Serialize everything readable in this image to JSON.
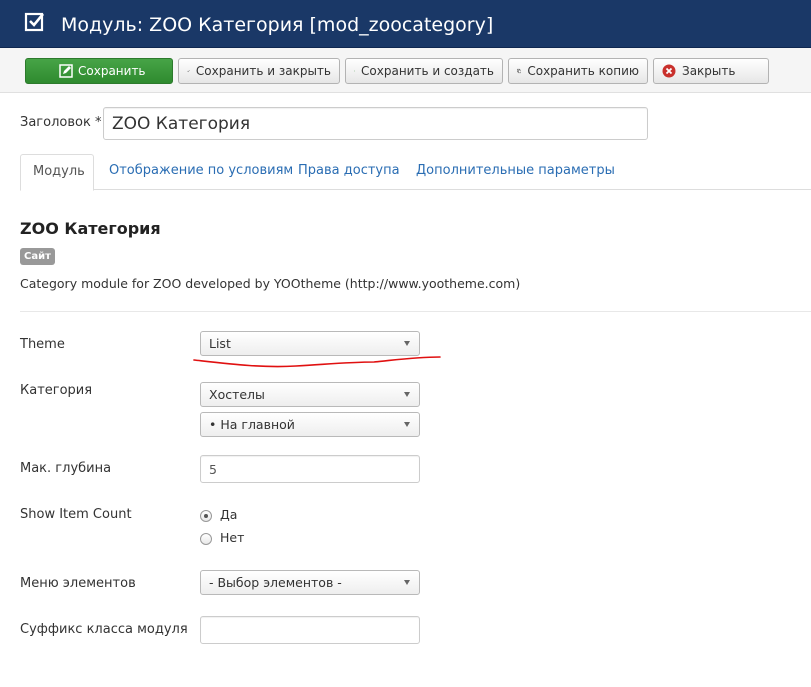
{
  "header": {
    "title": "Модуль: ZOO Категория [mod_zoocategory]",
    "icon": "checkbox-icon"
  },
  "toolbar": {
    "save_label": "Сохранить",
    "save_close_label": "Сохранить и закрыть",
    "save_new_label": "Сохранить и создать",
    "save_copy_label": "Сохранить копию",
    "close_label": "Закрыть"
  },
  "form": {
    "title_label": "Заголовок *",
    "title_value": "ZOO Категория"
  },
  "tabs": [
    {
      "label": "Модуль",
      "active": true
    },
    {
      "label": "Отображение по условиям",
      "active": false
    },
    {
      "label": "Права доступа",
      "active": false
    },
    {
      "label": "Дополнительные параметры",
      "active": false
    }
  ],
  "module": {
    "name": "ZOO Категория",
    "badge": "Сайт",
    "description": "Category module for ZOO developed by YOOtheme (http://www.yootheme.com)"
  },
  "fields": {
    "theme_label": "Theme",
    "theme_value": "List",
    "category_label": "Категория",
    "category_value": "Хостелы",
    "category_sub_value": "• На главной",
    "depth_label": "Мак. глубина",
    "depth_value": "5",
    "item_count_label": "Show Item Count",
    "item_count_yes": "Да",
    "item_count_no": "Нет",
    "item_count_selected": "Да",
    "menu_label": "Меню элементов",
    "menu_value": "- Выбор элементов -",
    "suffix_label": "Суффикс класса модуля",
    "suffix_value": ""
  },
  "colors": {
    "header_bg": "#1a3867",
    "save_green": "#3c9a3c",
    "link_blue": "#2a6db3",
    "annotation_red": "#e01010"
  }
}
